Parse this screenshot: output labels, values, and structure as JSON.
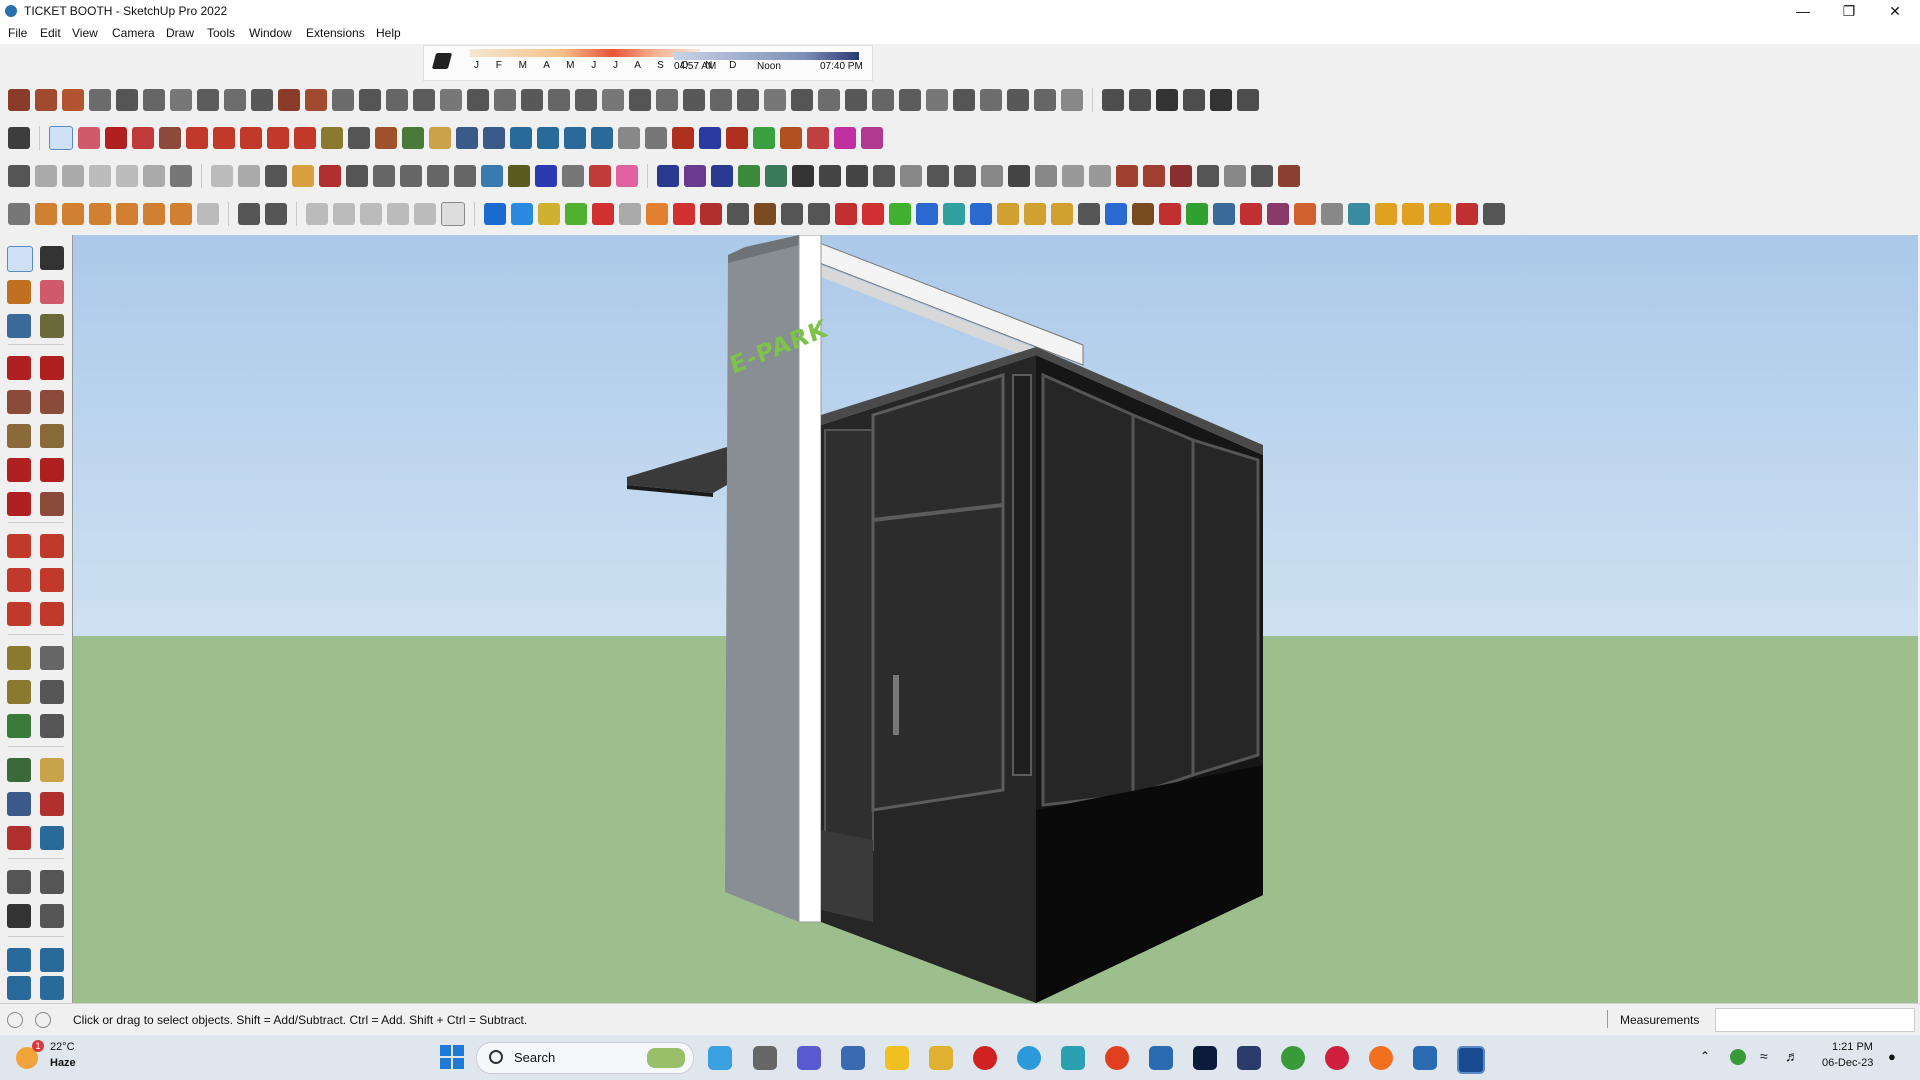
{
  "window": {
    "title": "TICKET BOOTH - SketchUp Pro 2022"
  },
  "menu": [
    "File",
    "Edit",
    "View",
    "Camera",
    "Draw",
    "Tools",
    "Window",
    "Extensions",
    "Help"
  ],
  "shadows": {
    "months": "J F M A M J J A S O N D",
    "time_start": "04:57 AM",
    "time_mid": "Noon",
    "time_end": "07:40 PM"
  },
  "model": {
    "sign_text": "E-PARK"
  },
  "status": {
    "hint": "Click or drag to select objects. Shift = Add/Subtract. Ctrl = Add. Shift + Ctrl = Subtract.",
    "measurements_label": "Measurements",
    "measurements_value": ""
  },
  "taskbar": {
    "weather_temp": "22°C",
    "weather_cond": "Haze",
    "weather_badge": "1",
    "search_label": "Search",
    "time": "1:21 PM",
    "date": "06-Dec-23"
  },
  "colors": {
    "accent": "#2a6fb0",
    "sky": "#acc9ea",
    "ground": "#9dbe8d",
    "sign": "#7ec24a"
  }
}
